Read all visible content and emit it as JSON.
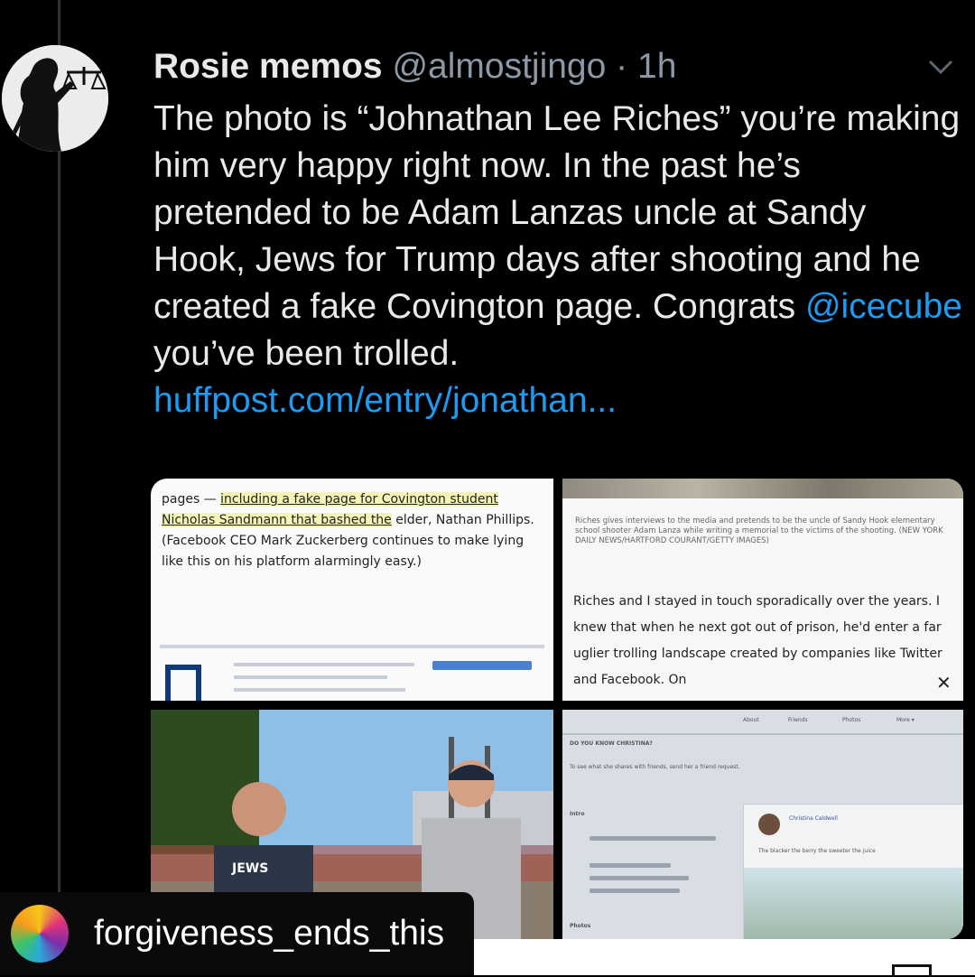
{
  "tweet": {
    "display_name": "Rosie memos",
    "handle": "@almostjingo",
    "separator": "·",
    "time": "1h",
    "text_part1": "The photo is “Johnathan Lee Riches” you’re making him very happy right now. In the past he’s pretended to be Adam Lanzas uncle at Sandy Hook, Jews for Trump days after shooting and he created a fake Covington page. Congrats ",
    "mention": "@icecube",
    "text_part2": " you’ve been trolled.",
    "link": "huffpost.com/entry/jonathan..."
  },
  "media": {
    "clip1": {
      "pre": "pages — ",
      "highlight": "including a fake page for Covington student Nicholas Sandmann that bashed the",
      "post": " elder, Nathan Phillips. (Facebook CEO Mark Zuckerberg continues to make lying like this on his platform alarmingly easy.)"
    },
    "clip2": {
      "caption": "Riches gives interviews to the media and pretends to be the uncle of Sandy Hook elementary school shooter Adam Lanza while writing a memorial to the victims of the shooting. (NEW YORK DAILY NEWS/HARTFORD COURANT/GETTY IMAGES)",
      "body": "Riches and I stayed in touch sporadically over the years. I knew that when he next got out of prison, he'd enter a far uglier trolling landscape created by companies like Twitter and Facebook. On",
      "close": "✕"
    },
    "photo": {
      "shirt_text": "JEWS"
    },
    "fb": {
      "tab_about": "About",
      "tab_friends": "Friends",
      "tab_photos": "Photos",
      "tab_more": "More ▾",
      "know_prompt": "DO YOU KNOW CHRISTINA?",
      "see_prompt": "To see what she shares with friends, send her a friend request.",
      "intro_label": "Intro",
      "post_name": "Christina Caldwell",
      "post_text": "The blacker the berry the sweeter the juice",
      "photos_label": "Photos"
    }
  },
  "repost": {
    "username": "forgiveness_ends_this"
  },
  "colors": {
    "background": "#000000",
    "text": "#e7e9ea",
    "secondary": "#8b98a5",
    "accent": "#1d9bf0"
  }
}
